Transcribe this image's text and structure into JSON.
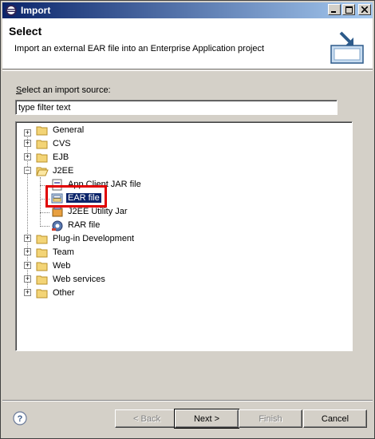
{
  "window": {
    "title": "Import"
  },
  "banner": {
    "heading": "Select",
    "description": "Import an external EAR file into an Enterprise Application project"
  },
  "source_label_prefix": "S",
  "source_label_rest": "elect an import source:",
  "filter": {
    "value": "type filter text"
  },
  "tree": {
    "items": [
      {
        "label": "General",
        "icon": "folder-icon",
        "expanded": false
      },
      {
        "label": "CVS",
        "icon": "folder-icon",
        "expanded": false
      },
      {
        "label": "EJB",
        "icon": "folder-icon",
        "expanded": false
      },
      {
        "label": "J2EE",
        "icon": "folder-open-icon",
        "expanded": true
      },
      {
        "label": "App Client JAR file",
        "icon": "jar-icon",
        "child": true
      },
      {
        "label": "EAR file",
        "icon": "ear-icon",
        "child": true,
        "selected": true
      },
      {
        "label": "J2EE Utility Jar",
        "icon": "utility-jar-icon",
        "child": true
      },
      {
        "label": "RAR file",
        "icon": "rar-icon",
        "child": true
      },
      {
        "label": "Plug-in Development",
        "icon": "folder-icon",
        "expanded": false
      },
      {
        "label": "Team",
        "icon": "folder-icon",
        "expanded": false
      },
      {
        "label": "Web",
        "icon": "folder-icon",
        "expanded": false
      },
      {
        "label": "Web services",
        "icon": "folder-icon",
        "expanded": false
      },
      {
        "label": "Other",
        "icon": "folder-icon",
        "expanded": false
      }
    ]
  },
  "buttons": {
    "back": "< Back",
    "next": "Next >",
    "finish": "Finish",
    "cancel": "Cancel"
  },
  "colors": {
    "title_gradient_start": "#0a246a",
    "selection": "#0a246a",
    "highlight_box": "#e00000",
    "dialog_bg": "#d4d0c8"
  }
}
